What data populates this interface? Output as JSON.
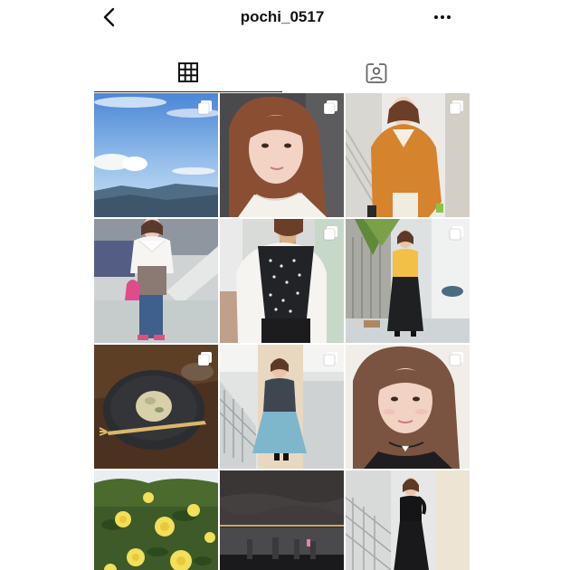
{
  "header": {
    "username": "pochi_0517",
    "back_icon": "chevron-left-icon",
    "more_icon": "more-horizontal-icon"
  },
  "tabs": [
    {
      "name": "posts-grid",
      "icon": "grid-icon",
      "active": true
    },
    {
      "name": "tagged",
      "icon": "tagged-user-icon",
      "active": false
    }
  ],
  "posts": [
    {
      "subject": "sky-and-clouds-over-mountains",
      "multi": true
    },
    {
      "subject": "selfie-closeup",
      "multi": true
    },
    {
      "subject": "orange-knit-cardigan",
      "multi": true
    },
    {
      "subject": "frilled-blouse-with-pink-bag",
      "multi": false
    },
    {
      "subject": "mirror-selfie-polka-vest",
      "multi": true
    },
    {
      "subject": "yellow-sweater-long-skirt",
      "multi": true
    },
    {
      "subject": "dessert-plate-with-fork",
      "multi": true
    },
    {
      "subject": "lace-top-blue-skirt",
      "multi": true
    },
    {
      "subject": "portrait-with-choker",
      "multi": true
    },
    {
      "subject": "yellow-roses",
      "multi": false
    },
    {
      "subject": "night-sky-over-water",
      "multi": false
    },
    {
      "subject": "black-dress-on-stairs",
      "multi": false
    }
  ],
  "colors": {
    "text": "#111111",
    "tab_indicator": "#222222",
    "background": "#ffffff"
  }
}
